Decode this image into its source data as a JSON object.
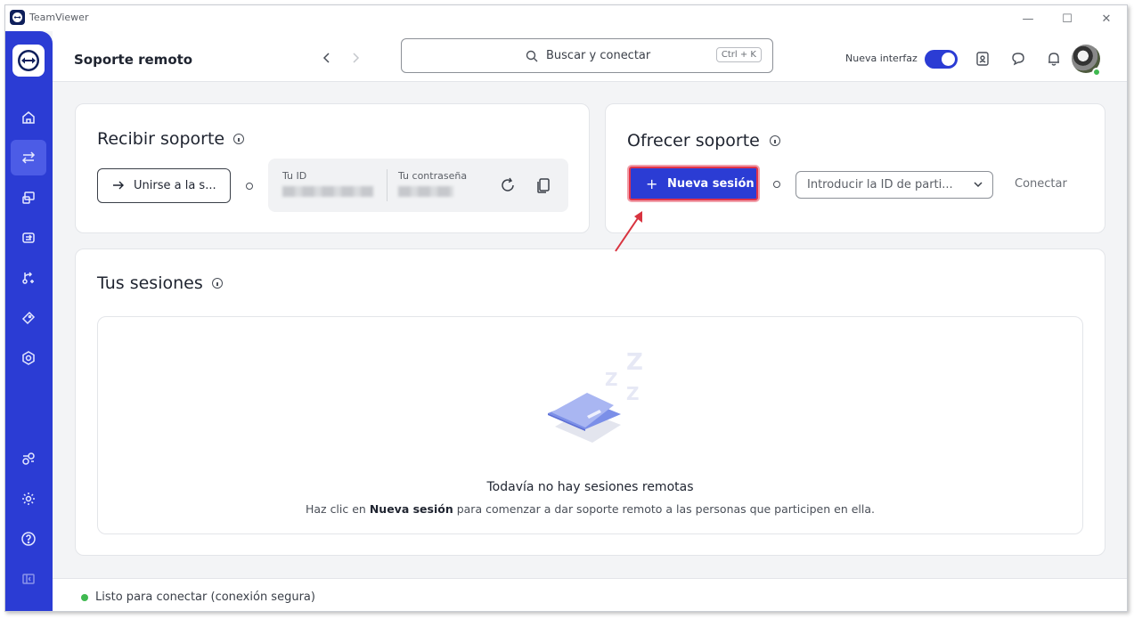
{
  "window": {
    "app_name": "TeamViewer",
    "controls": [
      "—",
      "☐",
      "✕"
    ]
  },
  "header": {
    "title": "Soporte remoto",
    "search_placeholder": "Buscar y conectar",
    "search_shortcut": "Ctrl + K",
    "new_interface_label": "Nueva interfaz",
    "new_interface_on": true
  },
  "receive": {
    "title": "Recibir soporte",
    "join_label": "Unirse a la s...",
    "id_label": "Tu ID",
    "password_label": "Tu contraseña"
  },
  "offer": {
    "title": "Ofrecer soporte",
    "new_session_label": "Nueva sesión",
    "partner_id_placeholder": "Introducir la ID de parti...",
    "connect_label": "Conectar"
  },
  "sessions": {
    "title": "Tus sesiones",
    "empty_title": "Todavía no hay sesiones remotas",
    "empty_sub_pre": "Haz clic en ",
    "empty_sub_bold": "Nueva sesión",
    "empty_sub_post": " para comenzar a dar soporte remoto a las personas que participen en ella."
  },
  "status": {
    "text": "Listo para conectar (conexión segura)"
  },
  "colors": {
    "accent": "#2b3cd4",
    "highlight": "#e0344a",
    "online": "#3fb950"
  }
}
